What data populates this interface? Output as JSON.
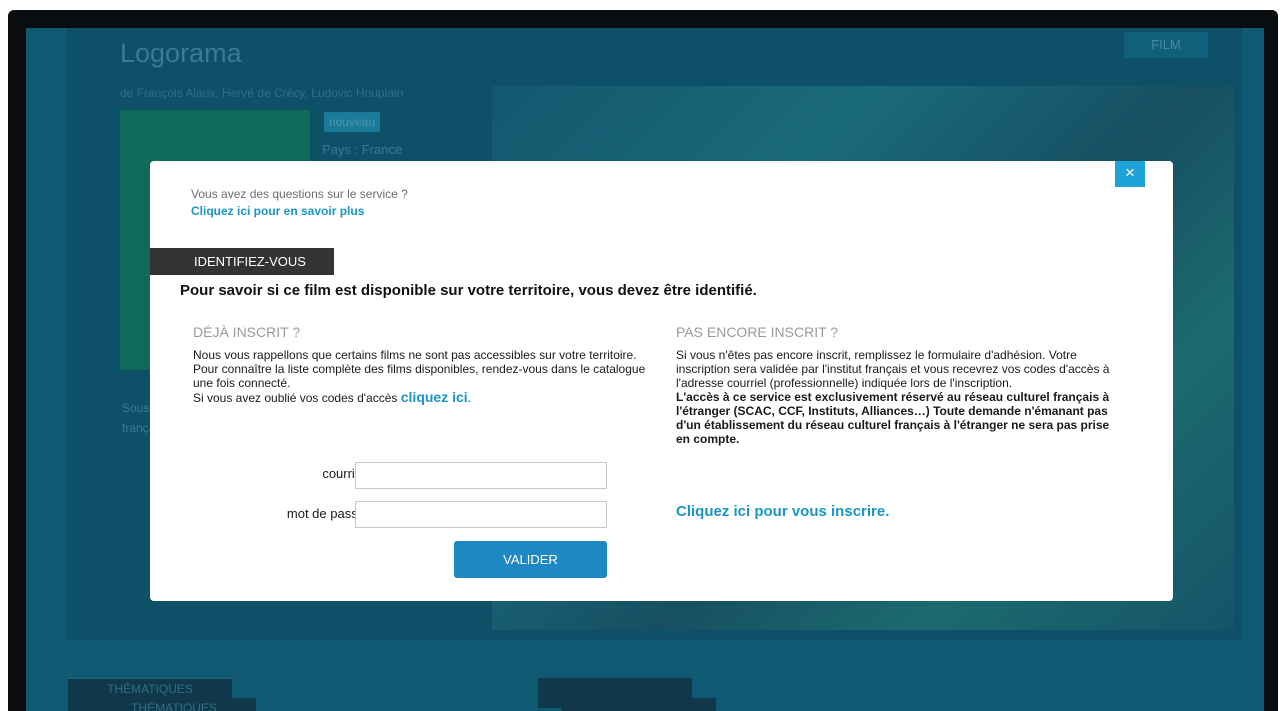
{
  "background_page": {
    "title": "Logorama",
    "film_tab": "FILM",
    "authors": "de François Alaux, Hervé de Crécy, Ludovic Houplain",
    "badge": "nouveau",
    "country": "Pays : France",
    "subtitles": "Sous-titres français",
    "tab_label_1": "THÉMATIQUES",
    "tab_label_2": "THÉMATIQUES"
  },
  "modal": {
    "close_label": "×",
    "help_question": "Vous avez des questions sur le service ?",
    "help_link": "Cliquez ici pour en savoir plus",
    "banner": "IDENTIFIEZ-VOUS",
    "headline": "Pour savoir si ce film est disponible sur votre territoire, vous devez être identifié.",
    "left": {
      "title": "DÉJÀ INSCRIT ?",
      "text_1": "Nous vous rappellons que certains films ne sont pas accessibles sur votre territoire.",
      "text_2": "Pour connaître la liste complète des films disponibles, rendez-vous dans le catalogue une fois connecté.",
      "text_3": "Si vous avez oublié vos codes d'accès",
      "forgot_link": "cliquez ici",
      "email_label": "courriel*",
      "password_label": "mot de passe*",
      "email_value": "",
      "password_value": "",
      "submit_label": "VALIDER"
    },
    "right": {
      "title": "PAS ENCORE INSCRIT ?",
      "text_1": "Si vous n'êtes pas encore inscrit, remplissez le formulaire d'adhésion. Votre inscription sera validée par l'institut français et vous recevrez vos codes d'accès à l'adresse courriel (professionnelle) indiquée lors de l'inscription.",
      "text_bold": "L'accès à ce service est exclusivement réservé au réseau culturel français à l'étranger (SCAC, CCF, Instituts, Alliances…) Toute demande n'émanant pas d'un établissement du réseau culturel français à l'étranger ne sera pas prise en compte.",
      "register_link": "Cliquez ici pour vous inscrire."
    }
  },
  "colors": {
    "accent": "#1a95c8",
    "button": "#1d88c4",
    "close": "#1ea3d8",
    "banner": "#333333",
    "overlay_bg": "#0e5a73"
  }
}
